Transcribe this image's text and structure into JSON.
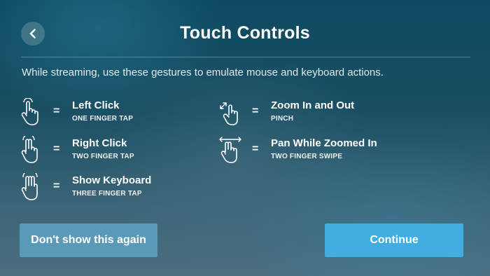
{
  "header": {
    "title": "Touch Controls",
    "back_icon": "chevron-left-icon"
  },
  "intro_text": "While streaming, use these gestures to emulate mouse and keyboard actions.",
  "equals_sign": "=",
  "gestures": [
    {
      "label": "Left Click",
      "sub": "ONE FINGER TAP",
      "icon": "one-finger-tap-icon"
    },
    {
      "label": "Right Click",
      "sub": "TWO FINGER TAP",
      "icon": "two-finger-tap-icon"
    },
    {
      "label": "Show Keyboard",
      "sub": "THREE FINGER TAP",
      "icon": "three-finger-tap-icon"
    },
    {
      "label": "Zoom In and Out",
      "sub": "PINCH",
      "icon": "pinch-zoom-icon"
    },
    {
      "label": "Pan While Zoomed In",
      "sub": "TWO FINGER SWIPE",
      "icon": "two-finger-swipe-icon"
    }
  ],
  "buttons": {
    "dont_show": "Don't show this again",
    "continue": "Continue"
  },
  "colors": {
    "primary_button": "#42aee0",
    "secondary_button": "#5a9ab8",
    "text": "#ffffff"
  }
}
